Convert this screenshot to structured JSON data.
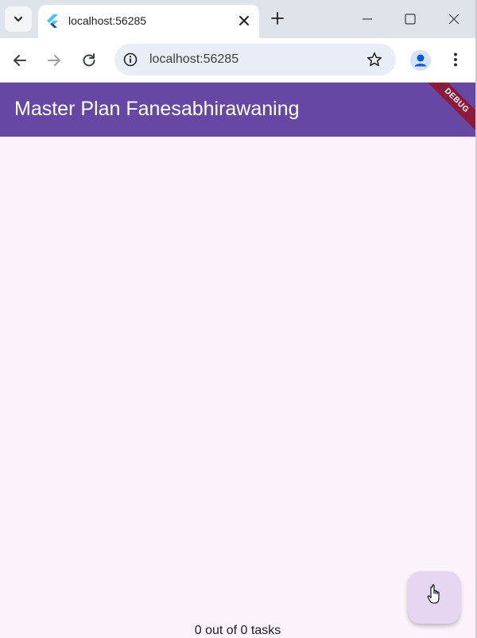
{
  "browser": {
    "tab": {
      "title": "localhost:56285"
    },
    "address_bar": {
      "url": "localhost:56285"
    }
  },
  "app": {
    "appbar_title": "Master Plan Fanesabhirawaning",
    "debug_banner": "DEBUG",
    "footer_text": "0 out of 0 tasks",
    "colors": {
      "appbar": "#6647a3",
      "background": "#fdf3fd",
      "fab": "#e6d6f2",
      "debug_ribbon": "#8c1b3a"
    }
  },
  "icons": [
    "chevron-down-icon",
    "flutter-icon",
    "close-icon",
    "plus-icon",
    "minimize-icon",
    "maximize-icon",
    "back-icon",
    "forward-icon",
    "reload-icon",
    "info-icon",
    "star-icon",
    "profile-icon",
    "more-vert-icon",
    "hand-cursor-icon"
  ]
}
